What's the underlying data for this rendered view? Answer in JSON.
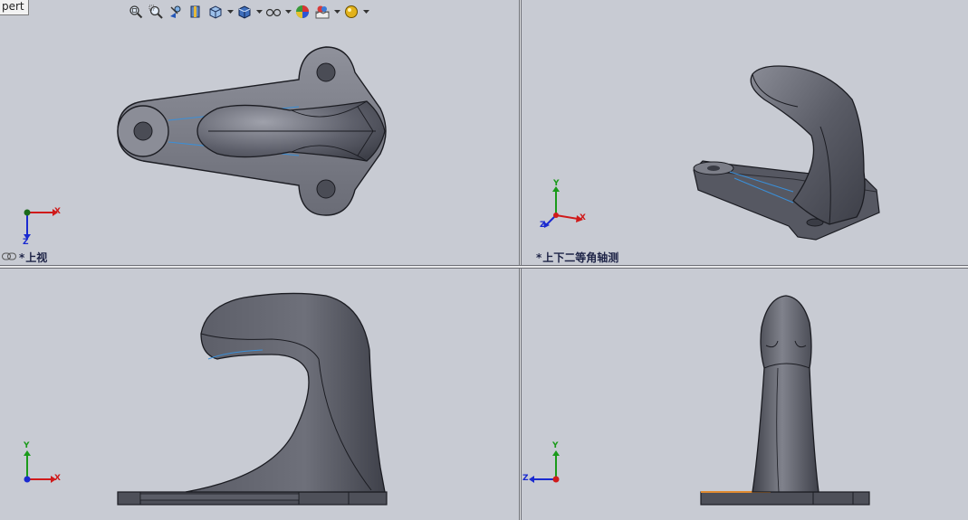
{
  "tab": {
    "label": "pert"
  },
  "toolbar": {
    "buttons": [
      {
        "name": "zoom-to-fit-icon"
      },
      {
        "name": "zoom-to-area-icon"
      },
      {
        "name": "previous-view-icon"
      },
      {
        "name": "section-view-icon"
      },
      {
        "name": "view-orientation-icon",
        "dropdown": true
      },
      {
        "name": "display-style-icon",
        "dropdown": true
      },
      {
        "name": "hide-show-items-icon",
        "dropdown": true
      },
      {
        "name": "edit-appearance-icon"
      },
      {
        "name": "apply-scene-icon",
        "dropdown": true
      },
      {
        "name": "view-settings-icon",
        "dropdown": true
      }
    ]
  },
  "viewports": {
    "top_left": {
      "label": "上视",
      "star": "*",
      "axes": {
        "a": "X",
        "b": "Z"
      }
    },
    "top_right": {
      "label": "上下二等角轴测",
      "star": "*",
      "axes": {
        "a": "X",
        "b": "Y",
        "c": "Z"
      }
    },
    "bottom_left": {
      "axes": {
        "a": "X",
        "b": "Y"
      }
    },
    "bottom_right": {
      "axes": {
        "a": "Z",
        "b": "Y"
      }
    }
  },
  "colors": {
    "background": "#c8cbd3",
    "part_fill": "#5c5e69",
    "part_light": "#9a9ca6",
    "part_edge": "#1b1c22",
    "axis_x": "#d01a1a",
    "axis_y": "#1a9a1a",
    "axis_z": "#1a2ad0",
    "label_text": "#1d2346"
  }
}
